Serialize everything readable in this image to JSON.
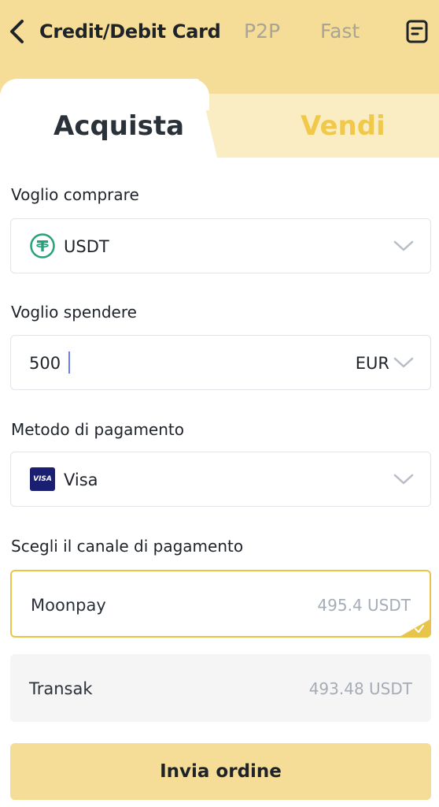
{
  "header": {
    "back_icon": "chevron-left-icon",
    "tabs": [
      {
        "label": "Credit/Debit Card",
        "active": true
      },
      {
        "label": "P2P",
        "active": false
      },
      {
        "label": "Fast",
        "active": false
      }
    ],
    "orders_icon": "order-list-icon"
  },
  "mode_tabs": {
    "buy": "Acquista",
    "sell": "Vendi",
    "active": "buy"
  },
  "form": {
    "buy_label": "Voglio comprare",
    "buy_asset": {
      "icon": "tether-icon",
      "value": "USDT"
    },
    "spend_label": "Voglio spendere",
    "spend_amount": "500",
    "spend_currency": "EUR",
    "payment_label": "Metodo di pagamento",
    "payment_method": {
      "icon": "visa-icon",
      "icon_text": "VISA",
      "value": "Visa"
    },
    "channel_label": "Scegli il canale di pagamento",
    "channels": [
      {
        "name": "Moonpay",
        "amount": "495.4 USDT",
        "selected": true
      },
      {
        "name": "Transak",
        "amount": "493.48 USDT",
        "selected": false
      }
    ]
  },
  "submit_label": "Invia ordine",
  "colors": {
    "header_bg": "#f5dc97",
    "accent": "#f0c94a",
    "selected_border": "#e8c54a",
    "tether": "#26a17b",
    "visa": "#1a1f71"
  }
}
